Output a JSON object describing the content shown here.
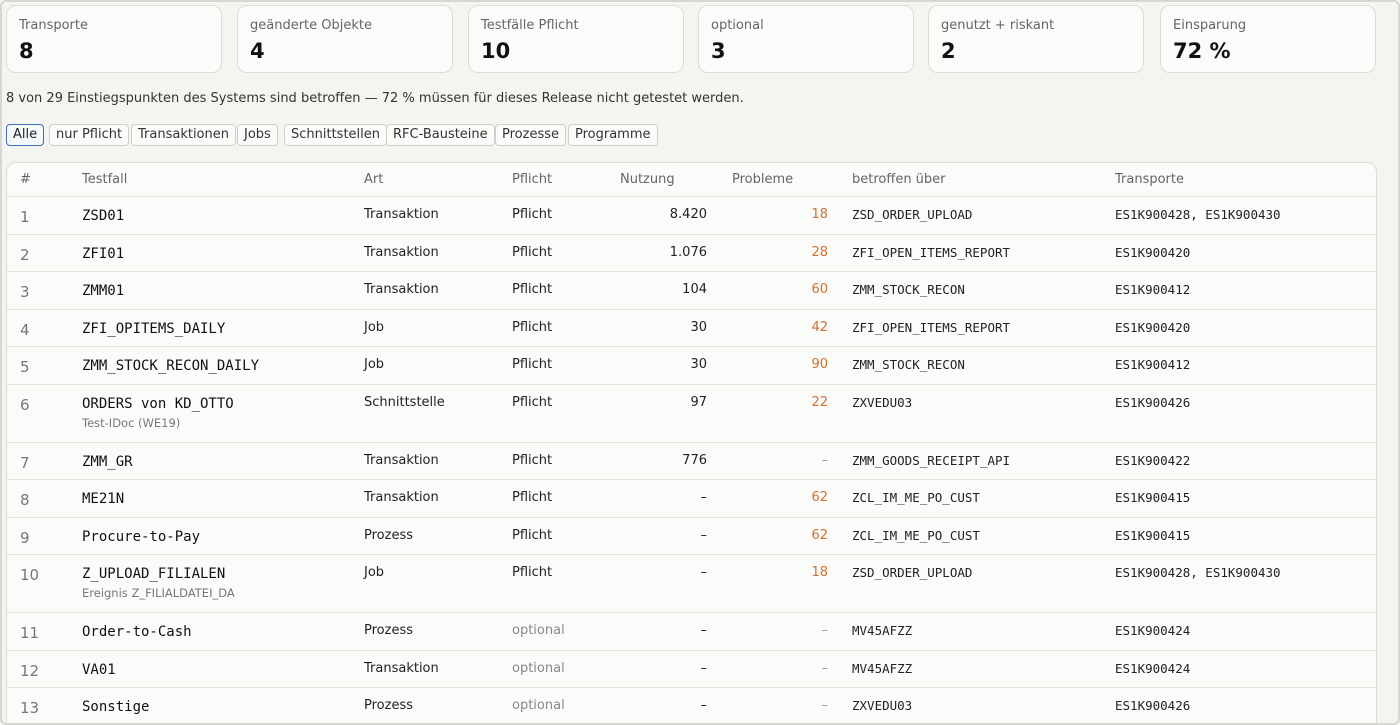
{
  "stats": [
    {
      "label": "Transporte",
      "value": "8"
    },
    {
      "label": "geänderte Objekte",
      "value": "4"
    },
    {
      "label": "Testfälle Pflicht",
      "value": "10"
    },
    {
      "label": "optional",
      "value": "3"
    },
    {
      "label": "genutzt + riskant",
      "value": "2"
    },
    {
      "label": "Einsparung",
      "value": "72 %"
    }
  ],
  "summary": "8 von 29 Einstiegspunkten des Systems sind betroffen — 72 % müssen für dieses Release nicht getestet werden.",
  "filters": [
    "Alle",
    "nur Pflicht",
    "Transaktionen",
    "Jobs",
    "Schnittstellen",
    "RFC-Bausteine",
    "Prozesse",
    "Programme"
  ],
  "active_filter": "Alle",
  "table": {
    "headers": [
      "#",
      "Testfall",
      "Art",
      "Pflicht",
      "Nutzung",
      "Probleme",
      "betroffen über",
      "Transporte"
    ],
    "rows": [
      {
        "n": "1",
        "testfall": "ZSD01",
        "sub": "",
        "art": "Transaktion",
        "pflicht": "Pflicht",
        "nutzung": "8.420",
        "probleme": "18",
        "ueber": "ZSD_ORDER_UPLOAD",
        "transporte": "ES1K900428, ES1K900430"
      },
      {
        "n": "2",
        "testfall": "ZFI01",
        "sub": "",
        "art": "Transaktion",
        "pflicht": "Pflicht",
        "nutzung": "1.076",
        "probleme": "28",
        "ueber": "ZFI_OPEN_ITEMS_REPORT",
        "transporte": "ES1K900420"
      },
      {
        "n": "3",
        "testfall": "ZMM01",
        "sub": "",
        "art": "Transaktion",
        "pflicht": "Pflicht",
        "nutzung": "104",
        "probleme": "60",
        "ueber": "ZMM_STOCK_RECON",
        "transporte": "ES1K900412"
      },
      {
        "n": "4",
        "testfall": "ZFI_OPITEMS_DAILY",
        "sub": "",
        "art": "Job",
        "pflicht": "Pflicht",
        "nutzung": "30",
        "probleme": "42",
        "ueber": "ZFI_OPEN_ITEMS_REPORT",
        "transporte": "ES1K900420"
      },
      {
        "n": "5",
        "testfall": "ZMM_STOCK_RECON_DAILY",
        "sub": "",
        "art": "Job",
        "pflicht": "Pflicht",
        "nutzung": "30",
        "probleme": "90",
        "ueber": "ZMM_STOCK_RECON",
        "transporte": "ES1K900412"
      },
      {
        "n": "6",
        "testfall": "ORDERS von KD_OTTO",
        "sub": "Test-IDoc (WE19)",
        "art": "Schnittstelle",
        "pflicht": "Pflicht",
        "nutzung": "97",
        "probleme": "22",
        "ueber": "ZXVEDU03",
        "transporte": "ES1K900426"
      },
      {
        "n": "7",
        "testfall": "ZMM_GR",
        "sub": "",
        "art": "Transaktion",
        "pflicht": "Pflicht",
        "nutzung": "776",
        "probleme": "–",
        "ueber": "ZMM_GOODS_RECEIPT_API",
        "transporte": "ES1K900422"
      },
      {
        "n": "8",
        "testfall": "ME21N",
        "sub": "",
        "art": "Transaktion",
        "pflicht": "Pflicht",
        "nutzung": "–",
        "probleme": "62",
        "ueber": "ZCL_IM_ME_PO_CUST",
        "transporte": "ES1K900415"
      },
      {
        "n": "9",
        "testfall": "Procure-to-Pay",
        "sub": "",
        "art": "Prozess",
        "pflicht": "Pflicht",
        "nutzung": "–",
        "probleme": "62",
        "ueber": "ZCL_IM_ME_PO_CUST",
        "transporte": "ES1K900415"
      },
      {
        "n": "10",
        "testfall": "Z_UPLOAD_FILIALEN",
        "sub": "Ereignis Z_FILIALDATEI_DA",
        "art": "Job",
        "pflicht": "Pflicht",
        "nutzung": "–",
        "probleme": "18",
        "ueber": "ZSD_ORDER_UPLOAD",
        "transporte": "ES1K900428, ES1K900430"
      },
      {
        "n": "11",
        "testfall": "Order-to-Cash",
        "sub": "",
        "art": "Prozess",
        "pflicht": "optional",
        "nutzung": "–",
        "probleme": "–",
        "ueber": "MV45AFZZ",
        "transporte": "ES1K900424"
      },
      {
        "n": "12",
        "testfall": "VA01",
        "sub": "",
        "art": "Transaktion",
        "pflicht": "optional",
        "nutzung": "–",
        "probleme": "–",
        "ueber": "MV45AFZZ",
        "transporte": "ES1K900424"
      },
      {
        "n": "13",
        "testfall": "Sonstige",
        "sub": "",
        "art": "Prozess",
        "pflicht": "optional",
        "nutzung": "–",
        "probleme": "–",
        "ueber": "ZXVEDU03",
        "transporte": "ES1K900426"
      }
    ]
  },
  "colors": {
    "accent": "#3e6fb4",
    "problem": "#d0712f",
    "muted": "#888888"
  }
}
